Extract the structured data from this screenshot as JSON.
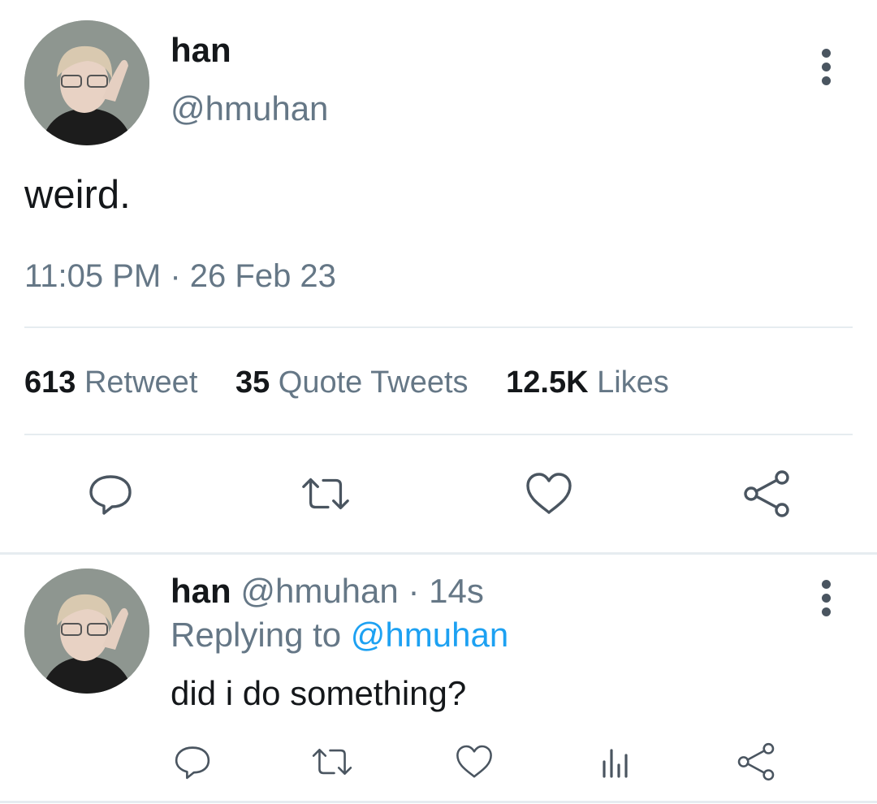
{
  "tweet": {
    "author_name": "han",
    "author_handle": "@hmuhan",
    "text": "weird.",
    "timestamp": "11:05 PM · 26 Feb 23",
    "stats": {
      "retweets_count": "613",
      "retweets_label": "Retweet",
      "quotes_count": "35",
      "quotes_label": "Quote Tweets",
      "likes_count": "12.5K",
      "likes_label": "Likes"
    },
    "actions": [
      "reply-icon",
      "retweet-icon",
      "like-icon",
      "share-icon"
    ]
  },
  "reply": {
    "author_name": "han",
    "author_handle": "@hmuhan",
    "separator": "·",
    "time": "14s",
    "replying_prefix": "Replying to",
    "replying_mention": "@hmuhan",
    "text": "did i do something?",
    "actions": [
      "reply-icon",
      "retweet-icon",
      "like-icon",
      "analytics-icon",
      "share-icon"
    ]
  },
  "colors": {
    "text_primary": "#14171a",
    "text_secondary": "#657786",
    "accent": "#1da1f2",
    "divider": "#e6ecf0",
    "icon": "#4a5560"
  }
}
